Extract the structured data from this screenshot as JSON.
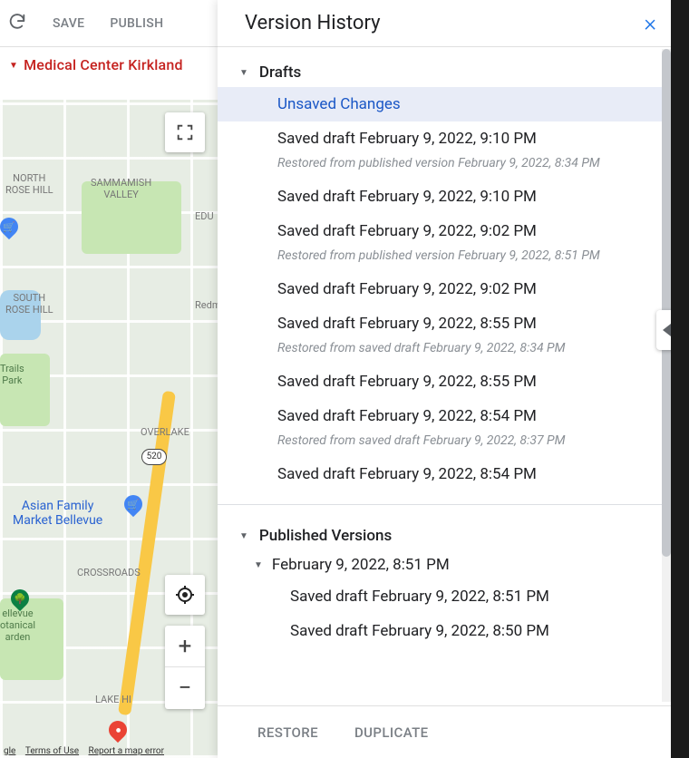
{
  "toolbar": {
    "save": "SAVE",
    "publish": "PUBLISH"
  },
  "panel_title": "Medical Center Kirkland",
  "map": {
    "labels": {
      "nrh": "NORTH\nROSE HILL",
      "sv": "SAMMAMISH\nVALLEY",
      "edu": "EDU",
      "srh": "SOUTH\nROSE HILL",
      "redm": "Redm",
      "trails": "Trails\nPark",
      "overlake": "OVERLAKE",
      "crossroads": "CROSSROADS",
      "market": "Asian Family\nMarket Bellevue",
      "garden": "ellevue\notanical\narden",
      "lake": "LAKE HI"
    },
    "hwy_shield": "520",
    "attribution": {
      "gle": "gle",
      "terms": "Terms of Use",
      "report": "Report a map error"
    }
  },
  "history": {
    "title": "Version History",
    "sections": {
      "drafts": "Drafts",
      "published": "Published Versions"
    },
    "selected": "Unsaved Changes",
    "drafts": [
      {
        "label": "Saved draft February 9, 2022, 9:10 PM",
        "note": "Restored from published version February 9, 2022, 8:34 PM"
      },
      {
        "label": "Saved draft February 9, 2022, 9:10 PM"
      },
      {
        "label": "Saved draft February 9, 2022, 9:02 PM",
        "note": "Restored from published version February 9, 2022, 8:51 PM"
      },
      {
        "label": "Saved draft February 9, 2022, 9:02 PM"
      },
      {
        "label": "Saved draft February 9, 2022, 8:55 PM",
        "note": "Restored from saved draft February 9, 2022, 8:34 PM"
      },
      {
        "label": "Saved draft February 9, 2022, 8:55 PM"
      },
      {
        "label": "Saved draft February 9, 2022, 8:54 PM",
        "note": "Restored from saved draft February 9, 2022, 8:37 PM"
      },
      {
        "label": "Saved draft February 9, 2022, 8:54 PM"
      }
    ],
    "published": {
      "date": "February 9, 2022, 8:51 PM",
      "items": [
        "Saved draft February 9, 2022, 8:51 PM",
        "Saved draft February 9, 2022, 8:50 PM"
      ]
    },
    "footer": {
      "restore": "RESTORE",
      "duplicate": "DUPLICATE"
    }
  }
}
